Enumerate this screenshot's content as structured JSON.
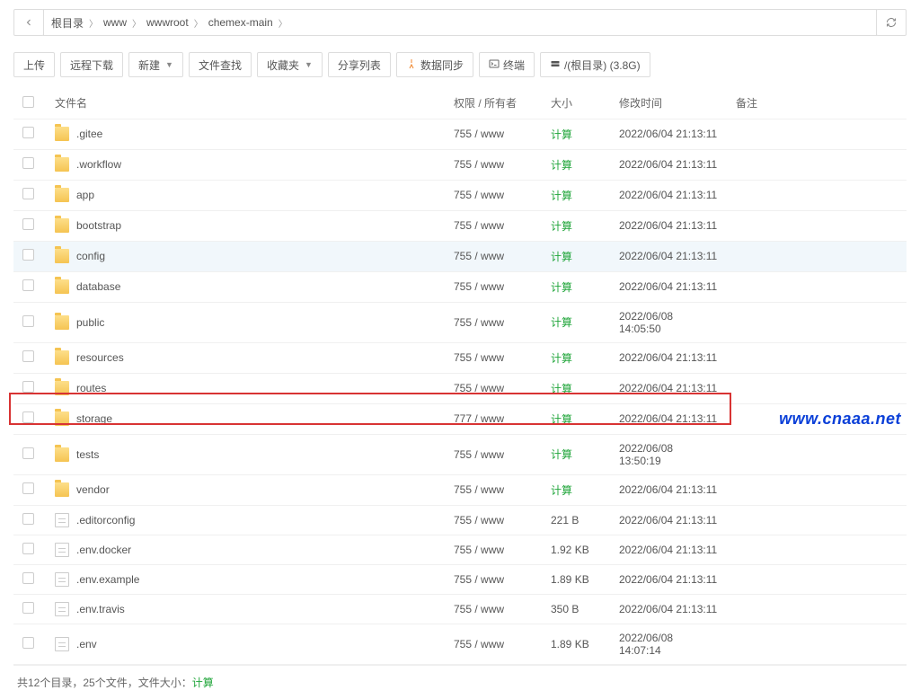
{
  "breadcrumb": {
    "items": [
      "根目录",
      "www",
      "wwwroot",
      "chemex-main"
    ]
  },
  "toolbar": {
    "upload": "上传",
    "remote_dl": "远程下载",
    "new": "新建",
    "file_search": "文件查找",
    "favorite": "收藏夹",
    "share_list": "分享列表",
    "data_sync": "数据同步",
    "terminal": "终端",
    "disk": "/(根目录) (3.8G)"
  },
  "columns": {
    "name": "文件名",
    "perm": "权限 / 所有者",
    "size": "大小",
    "mtime": "修改时间",
    "note": "备注"
  },
  "size_calc_label": "计算",
  "rows": [
    {
      "type": "folder",
      "name": ".gitee",
      "perm": "755 / www",
      "size_calc": true,
      "size": "",
      "mtime": "2022/06/04 21:13:11"
    },
    {
      "type": "folder",
      "name": ".workflow",
      "perm": "755 / www",
      "size_calc": true,
      "size": "",
      "mtime": "2022/06/04 21:13:11"
    },
    {
      "type": "folder",
      "name": "app",
      "perm": "755 / www",
      "size_calc": true,
      "size": "",
      "mtime": "2022/06/04 21:13:11"
    },
    {
      "type": "folder",
      "name": "bootstrap",
      "perm": "755 / www",
      "size_calc": true,
      "size": "",
      "mtime": "2022/06/04 21:13:11"
    },
    {
      "type": "folder",
      "name": "config",
      "perm": "755 / www",
      "size_calc": true,
      "size": "",
      "mtime": "2022/06/04 21:13:11",
      "hover": true
    },
    {
      "type": "folder",
      "name": "database",
      "perm": "755 / www",
      "size_calc": true,
      "size": "",
      "mtime": "2022/06/04 21:13:11"
    },
    {
      "type": "folder",
      "name": "public",
      "perm": "755 / www",
      "size_calc": true,
      "size": "",
      "mtime": "2022/06/08 14:05:50"
    },
    {
      "type": "folder",
      "name": "resources",
      "perm": "755 / www",
      "size_calc": true,
      "size": "",
      "mtime": "2022/06/04 21:13:11"
    },
    {
      "type": "folder",
      "name": "routes",
      "perm": "755 / www",
      "size_calc": true,
      "size": "",
      "mtime": "2022/06/04 21:13:11"
    },
    {
      "type": "folder",
      "name": "storage",
      "perm": "777 / www",
      "size_calc": true,
      "size": "",
      "mtime": "2022/06/04 21:13:11",
      "highlight": true
    },
    {
      "type": "folder",
      "name": "tests",
      "perm": "755 / www",
      "size_calc": true,
      "size": "",
      "mtime": "2022/06/08 13:50:19"
    },
    {
      "type": "folder",
      "name": "vendor",
      "perm": "755 / www",
      "size_calc": true,
      "size": "",
      "mtime": "2022/06/04 21:13:11"
    },
    {
      "type": "file",
      "name": ".editorconfig",
      "perm": "755 / www",
      "size_calc": false,
      "size": "221 B",
      "mtime": "2022/06/04 21:13:11"
    },
    {
      "type": "file",
      "name": ".env.docker",
      "perm": "755 / www",
      "size_calc": false,
      "size": "1.92 KB",
      "mtime": "2022/06/04 21:13:11"
    },
    {
      "type": "file",
      "name": ".env.example",
      "perm": "755 / www",
      "size_calc": false,
      "size": "1.89 KB",
      "mtime": "2022/06/04 21:13:11"
    },
    {
      "type": "file",
      "name": ".env.travis",
      "perm": "755 / www",
      "size_calc": false,
      "size": "350 B",
      "mtime": "2022/06/04 21:13:11"
    },
    {
      "type": "file",
      "name": ".env",
      "perm": "755 / www",
      "size_calc": false,
      "size": "1.89 KB",
      "mtime": "2022/06/08 14:07:14"
    }
  ],
  "footer": {
    "prefix": "共12个目录，25个文件，文件大小：",
    "calc": "计算"
  },
  "watermark": "www.cnaaa.net"
}
